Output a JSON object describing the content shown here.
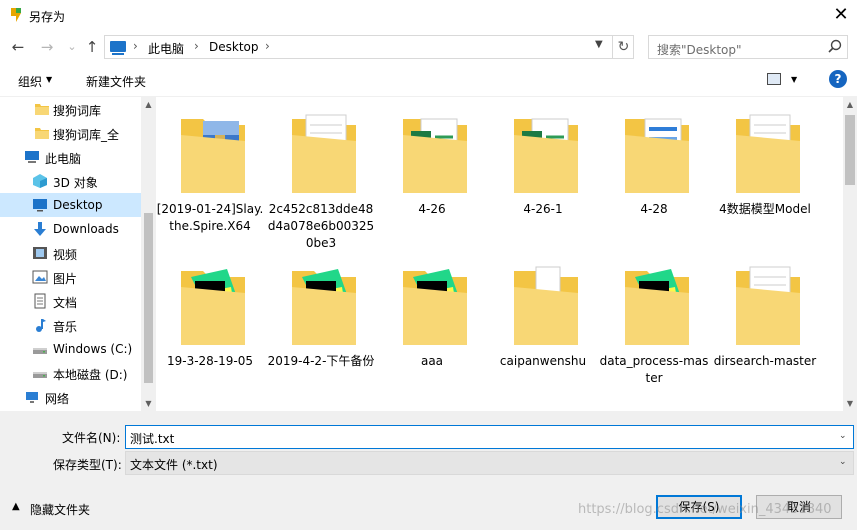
{
  "window": {
    "title": "另存为",
    "close_glyph": "✕"
  },
  "nav": {
    "back_glyph": "←",
    "forward_glyph": "→",
    "recent_glyph": "⌄",
    "up_glyph": "↑",
    "breadcrumbs": [
      "此电脑",
      "Desktop"
    ],
    "crumb_sep": "›",
    "refresh_glyph": "↻",
    "search_placeholder": "搜索\"Desktop\""
  },
  "toolbar": {
    "organize_label": "组织",
    "new_folder_label": "新建文件夹",
    "help_label": "?"
  },
  "sidebar": {
    "items": [
      {
        "label": "搜狗词库",
        "icon": "folder-icon",
        "indent": "folder"
      },
      {
        "label": "搜狗词库_全",
        "icon": "folder-icon",
        "indent": "folder"
      },
      {
        "label": "此电脑",
        "icon": "pc-icon",
        "indent": "root"
      },
      {
        "label": "3D 对象",
        "icon": "cube-icon",
        "indent": "child"
      },
      {
        "label": "Desktop",
        "icon": "desktop-icon",
        "indent": "child",
        "selected": true
      },
      {
        "label": "Downloads",
        "icon": "download-icon",
        "indent": "child"
      },
      {
        "label": "视频",
        "icon": "video-icon",
        "indent": "child"
      },
      {
        "label": "图片",
        "icon": "picture-icon",
        "indent": "child"
      },
      {
        "label": "文档",
        "icon": "document-icon",
        "indent": "child"
      },
      {
        "label": "音乐",
        "icon": "music-icon",
        "indent": "child"
      },
      {
        "label": "Windows (C:)",
        "icon": "drive-icon",
        "indent": "child"
      },
      {
        "label": "本地磁盘 (D:)",
        "icon": "drive-icon",
        "indent": "child"
      },
      {
        "label": "网络",
        "icon": "network-icon",
        "indent": "root"
      }
    ]
  },
  "files": [
    {
      "label": "[2019-01-24]Slay.the.Spire.X64",
      "icon": "winrar-folder-icon"
    },
    {
      "label": "2c452c813dde48d4a078e6b003250be3",
      "icon": "document-folder-icon"
    },
    {
      "label": "4-26",
      "icon": "excel-folder-icon"
    },
    {
      "label": "4-26-1",
      "icon": "excel-folder-icon"
    },
    {
      "label": "4-28",
      "icon": "sheet-folder-icon"
    },
    {
      "label": "4数据模型Model",
      "icon": "document-folder-icon"
    },
    {
      "label": "19-3-28-19-05",
      "icon": "pycharm-folder-icon"
    },
    {
      "label": "2019-4-2-下午备份",
      "icon": "pycharm-folder-icon"
    },
    {
      "label": "aaa",
      "icon": "pycharm-folder-icon"
    },
    {
      "label": "caipanwenshu",
      "icon": "zip-folder-icon"
    },
    {
      "label": "data_process-master",
      "icon": "pycharm-folder-icon"
    },
    {
      "label": "dirsearch-master",
      "icon": "document-folder-icon"
    },
    {
      "label": "",
      "icon": "folder-icon"
    },
    {
      "label": "",
      "icon": "folder-icon"
    },
    {
      "label": "",
      "icon": "folder-icon"
    },
    {
      "label": "",
      "icon": "folder-icon"
    },
    {
      "label": "",
      "icon": "folder-icon"
    },
    {
      "label": "",
      "icon": "folder-icon"
    }
  ],
  "form": {
    "filename_label": "文件名(N):",
    "filename_value": "测试.txt",
    "filetype_label": "保存类型(T):",
    "filetype_value": "文本文件 (*.txt)",
    "hide_folders_label": "隐藏文件夹",
    "save_label": "保存(S)",
    "cancel_label": "取消"
  },
  "watermark": "https://blog.csdn.net/weixin_43431840",
  "colors": {
    "selection": "#cce8ff",
    "accent": "#0078d7",
    "folder": "#f8d775"
  }
}
